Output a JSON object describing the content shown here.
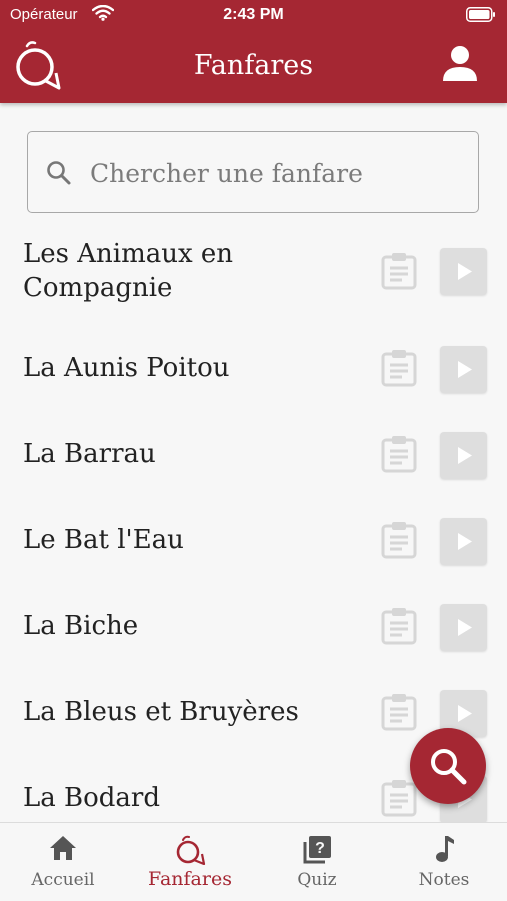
{
  "status_bar": {
    "carrier": "Opérateur",
    "time": "2:43 PM"
  },
  "header": {
    "title": "Fanfares"
  },
  "search": {
    "placeholder": "Chercher une fanfare",
    "value": ""
  },
  "fanfares": [
    {
      "title": "Les Animaux en Compagnie"
    },
    {
      "title": "La Aunis Poitou"
    },
    {
      "title": "La Barrau"
    },
    {
      "title": "Le Bat l'Eau"
    },
    {
      "title": "La Biche"
    },
    {
      "title": "La Bleus et Bruyères"
    },
    {
      "title": "La Bodard"
    }
  ],
  "tabs": [
    {
      "label": "Accueil",
      "icon": "home-icon",
      "active": false
    },
    {
      "label": "Fanfares",
      "icon": "horn-icon",
      "active": true
    },
    {
      "label": "Quiz",
      "icon": "quiz-icon",
      "active": false
    },
    {
      "label": "Notes",
      "icon": "music-note-icon",
      "active": false
    }
  ],
  "colors": {
    "brand": "#a52733",
    "background": "#f7f7f7",
    "inactive_tab": "#666666",
    "button_disabled": "#dedede"
  }
}
